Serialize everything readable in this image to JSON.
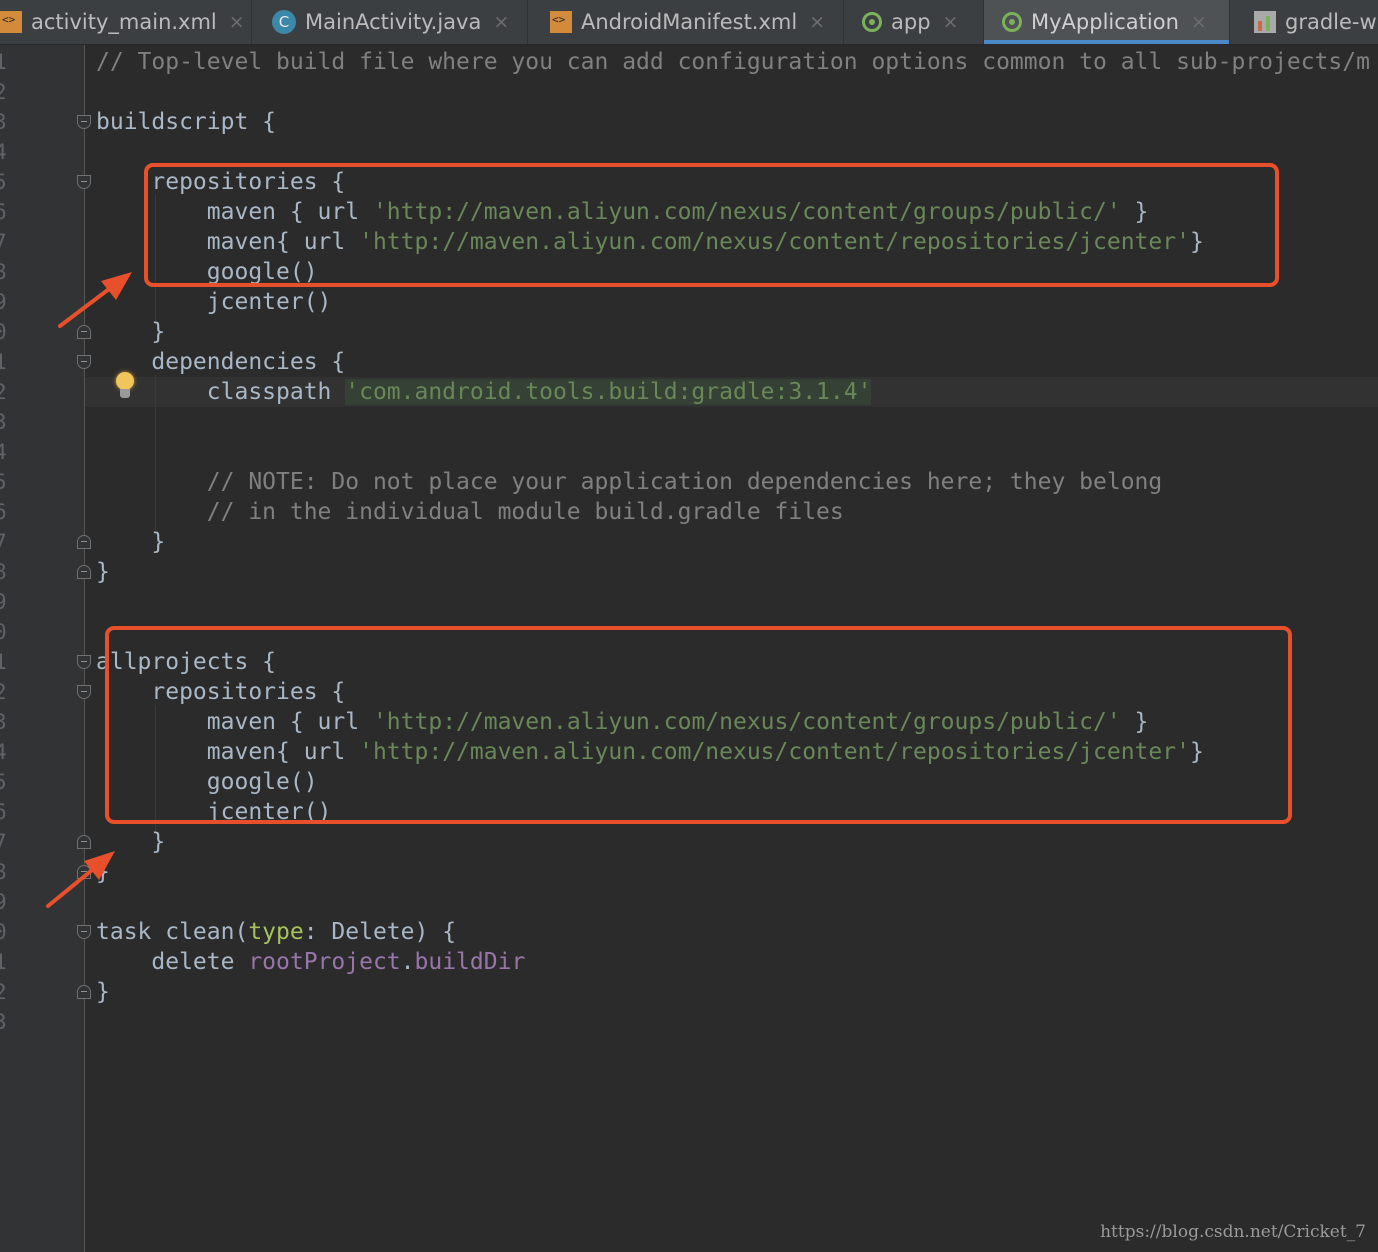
{
  "tabs": [
    {
      "label": "activity_main.xml",
      "icon": "xml-file-icon",
      "active": false
    },
    {
      "label": "MainActivity.java",
      "icon": "java-class-icon",
      "active": false
    },
    {
      "label": "AndroidManifest.xml",
      "icon": "manifest-file-icon",
      "active": false
    },
    {
      "label": "app",
      "icon": "gradle-module-icon",
      "active": false
    },
    {
      "label": "MyApplication",
      "icon": "gradle-module-icon",
      "active": true
    },
    {
      "label": "gradle-w",
      "icon": "gradle-wrapper-icon",
      "active": false
    }
  ],
  "close_glyph": "×",
  "gutter": {
    "line_numbers": [
      "1",
      "2",
      "3",
      "4",
      "5",
      "6",
      "7",
      "8",
      "9",
      "0",
      "1",
      "2",
      "3",
      "4",
      "5",
      "6",
      "7",
      "8",
      "9",
      "0",
      "1",
      "2",
      "3",
      "4",
      "5",
      "6",
      "7",
      "8",
      "9",
      "0",
      "1",
      "2",
      "3"
    ]
  },
  "code_lines": [
    "// Top-level build file where you can add configuration options common to all sub-projects/m",
    "",
    "buildscript {",
    "",
    "    repositories {",
    "        maven { url 'http://maven.aliyun.com/nexus/content/groups/public/' }",
    "        maven{ url 'http://maven.aliyun.com/nexus/content/repositories/jcenter'}",
    "        google()",
    "        jcenter()",
    "    }",
    "    dependencies {",
    "        classpath 'com.android.tools.build:gradle:3.1.4'",
    "",
    "",
    "        // NOTE: Do not place your application dependencies here; they belong",
    "        // in the individual module build.gradle files",
    "    }",
    "}",
    "",
    "",
    "allprojects {",
    "    repositories {",
    "        maven { url 'http://maven.aliyun.com/nexus/content/groups/public/' }",
    "        maven{ url 'http://maven.aliyun.com/nexus/content/repositories/jcenter'}",
    "        google()",
    "        jcenter()",
    "    }",
    "}",
    "",
    "task clean(type: Delete) {",
    "    delete rootProject.buildDir",
    "}",
    ""
  ],
  "colors": {
    "editor_background": "#2b2b2b",
    "comment": "#808080",
    "string": "#6a8759",
    "keyword": "#a9b7c6",
    "named_param": "#a5c25c",
    "property": "#9876aa",
    "annotation": "#e8502b"
  },
  "intention_icon": "lightbulb-icon",
  "watermark": "https://blog.csdn.net/Cricket_7"
}
